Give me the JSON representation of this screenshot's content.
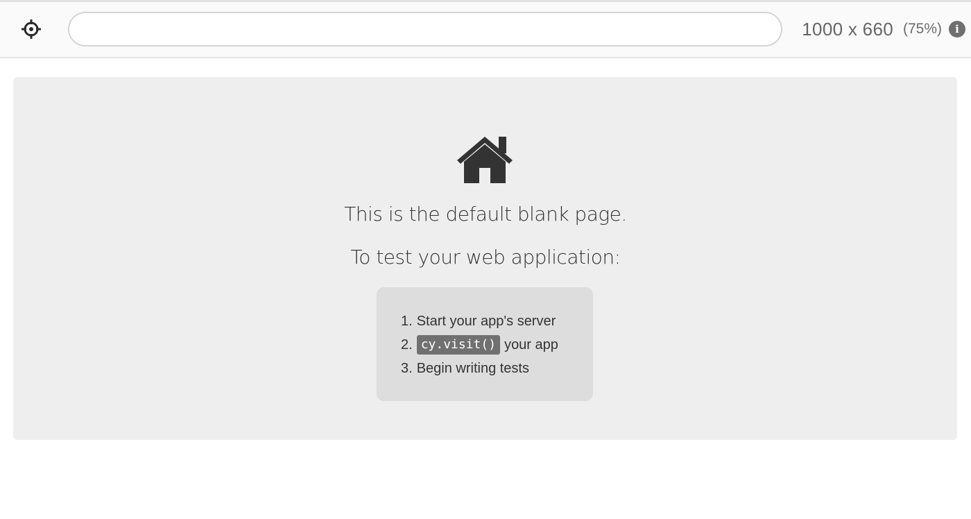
{
  "toolbar": {
    "url_value": "",
    "viewport_size": "1000 x 660",
    "viewport_scale": "(75%)",
    "info_glyph": "i",
    "icons": [
      "crosshair-icon",
      "info-icon"
    ]
  },
  "blank_page": {
    "icon": "home-icon",
    "headline": "This is the default blank page.",
    "subheadline": "To test your web application:",
    "steps": [
      {
        "number": "1.",
        "text": "Start your app's server"
      },
      {
        "number": "2.",
        "code": "cy.visit()",
        "text": "your app"
      },
      {
        "number": "3.",
        "text": "Begin writing tests"
      }
    ]
  }
}
